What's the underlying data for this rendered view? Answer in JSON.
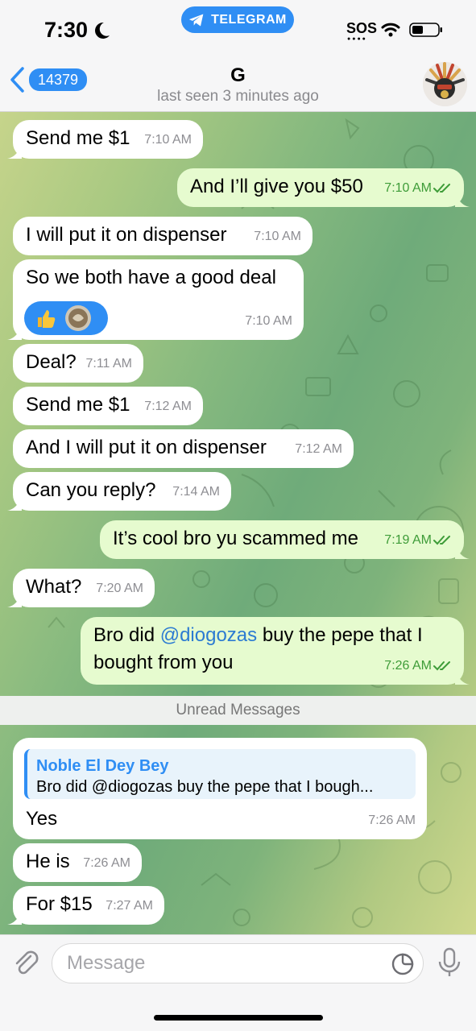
{
  "status_bar": {
    "time": "7:30",
    "app_pill": "TELEGRAM",
    "sos": "SOS"
  },
  "header": {
    "back_count": "14379",
    "title": "G",
    "subtitle": "last seen 3 minutes ago"
  },
  "messages": [
    {
      "dir": "in",
      "text": "Send me $1",
      "time": "7:10 AM"
    },
    {
      "dir": "out",
      "text": "And I’ll give you $50",
      "time": "7:10 AM",
      "read": true
    },
    {
      "dir": "in",
      "text": "I will put it on dispenser",
      "time": "7:10 AM"
    },
    {
      "dir": "in",
      "text": "So we both have a good deal",
      "time": "7:10 AM",
      "emojis": [
        "thumbs-up",
        "coin"
      ]
    },
    {
      "dir": "in",
      "text": "Deal?",
      "time": "7:11 AM"
    },
    {
      "dir": "in",
      "text": "Send me $1",
      "time": "7:12 AM"
    },
    {
      "dir": "in",
      "text": "And I will put it on dispenser",
      "time": "7:12 AM"
    },
    {
      "dir": "in",
      "text": "Can you reply?",
      "time": "7:14 AM"
    },
    {
      "dir": "out",
      "text": "It’s cool bro yu scammed me",
      "time": "7:19 AM",
      "read": true
    },
    {
      "dir": "in",
      "text": "What?",
      "time": "7:20 AM"
    },
    {
      "dir": "out",
      "text_line1_a": "Bro did ",
      "mention": "@diogozas",
      "text_line1_b": " buy the pepe that I",
      "text_line2": "bought from you",
      "time": "7:26 AM",
      "read": true
    },
    {
      "dir": "in",
      "reply_name": "Noble El Dey Bey",
      "reply_text": "Bro did @diogozas buy the pepe that I bough...",
      "text": "Yes",
      "time": "7:26 AM"
    },
    {
      "dir": "in",
      "text": "He is",
      "time": "7:26 AM"
    },
    {
      "dir": "in",
      "text": "For $15",
      "time": "7:27 AM"
    }
  ],
  "unread_divider": "Unread Messages",
  "input": {
    "placeholder": "Message"
  },
  "icons": {
    "back": "chevron-left-icon",
    "attach": "paperclip-icon",
    "sticker": "sticker-icon",
    "mic": "microphone-icon",
    "ticks": "double-check-icon"
  },
  "colors": {
    "accent": "#2f8ef4",
    "outgoing_bubble": "#e6fbcf",
    "incoming_bubble": "#ffffff",
    "read_ticks": "#3e9c38"
  }
}
